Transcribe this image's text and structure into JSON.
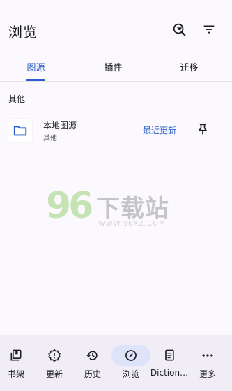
{
  "app": {
    "title": "浏览"
  },
  "tabs": [
    {
      "label": "图源",
      "active": true
    },
    {
      "label": "插件",
      "active": false
    },
    {
      "label": "迁移",
      "active": false
    }
  ],
  "section": {
    "label": "其他"
  },
  "source": {
    "name": "本地图源",
    "subtitle": "其他",
    "latest_label": "最近更新"
  },
  "watermark": {
    "number": "96",
    "text": "下载站",
    "url": "WWW.96XZ.COM"
  },
  "bottom_nav": [
    {
      "label": "书架",
      "icon": "bookshelf-icon"
    },
    {
      "label": "更新",
      "icon": "alert-badge-icon"
    },
    {
      "label": "历史",
      "icon": "history-icon"
    },
    {
      "label": "浏览",
      "icon": "compass-icon",
      "active": true
    },
    {
      "label": "Diction…",
      "icon": "dictionary-icon"
    },
    {
      "label": "更多",
      "icon": "more-icon"
    }
  ],
  "colors": {
    "accent": "#2a60c9",
    "background": "#fbf8fe",
    "nav_background": "#f1edf7",
    "active_pill": "#dde3f9"
  }
}
